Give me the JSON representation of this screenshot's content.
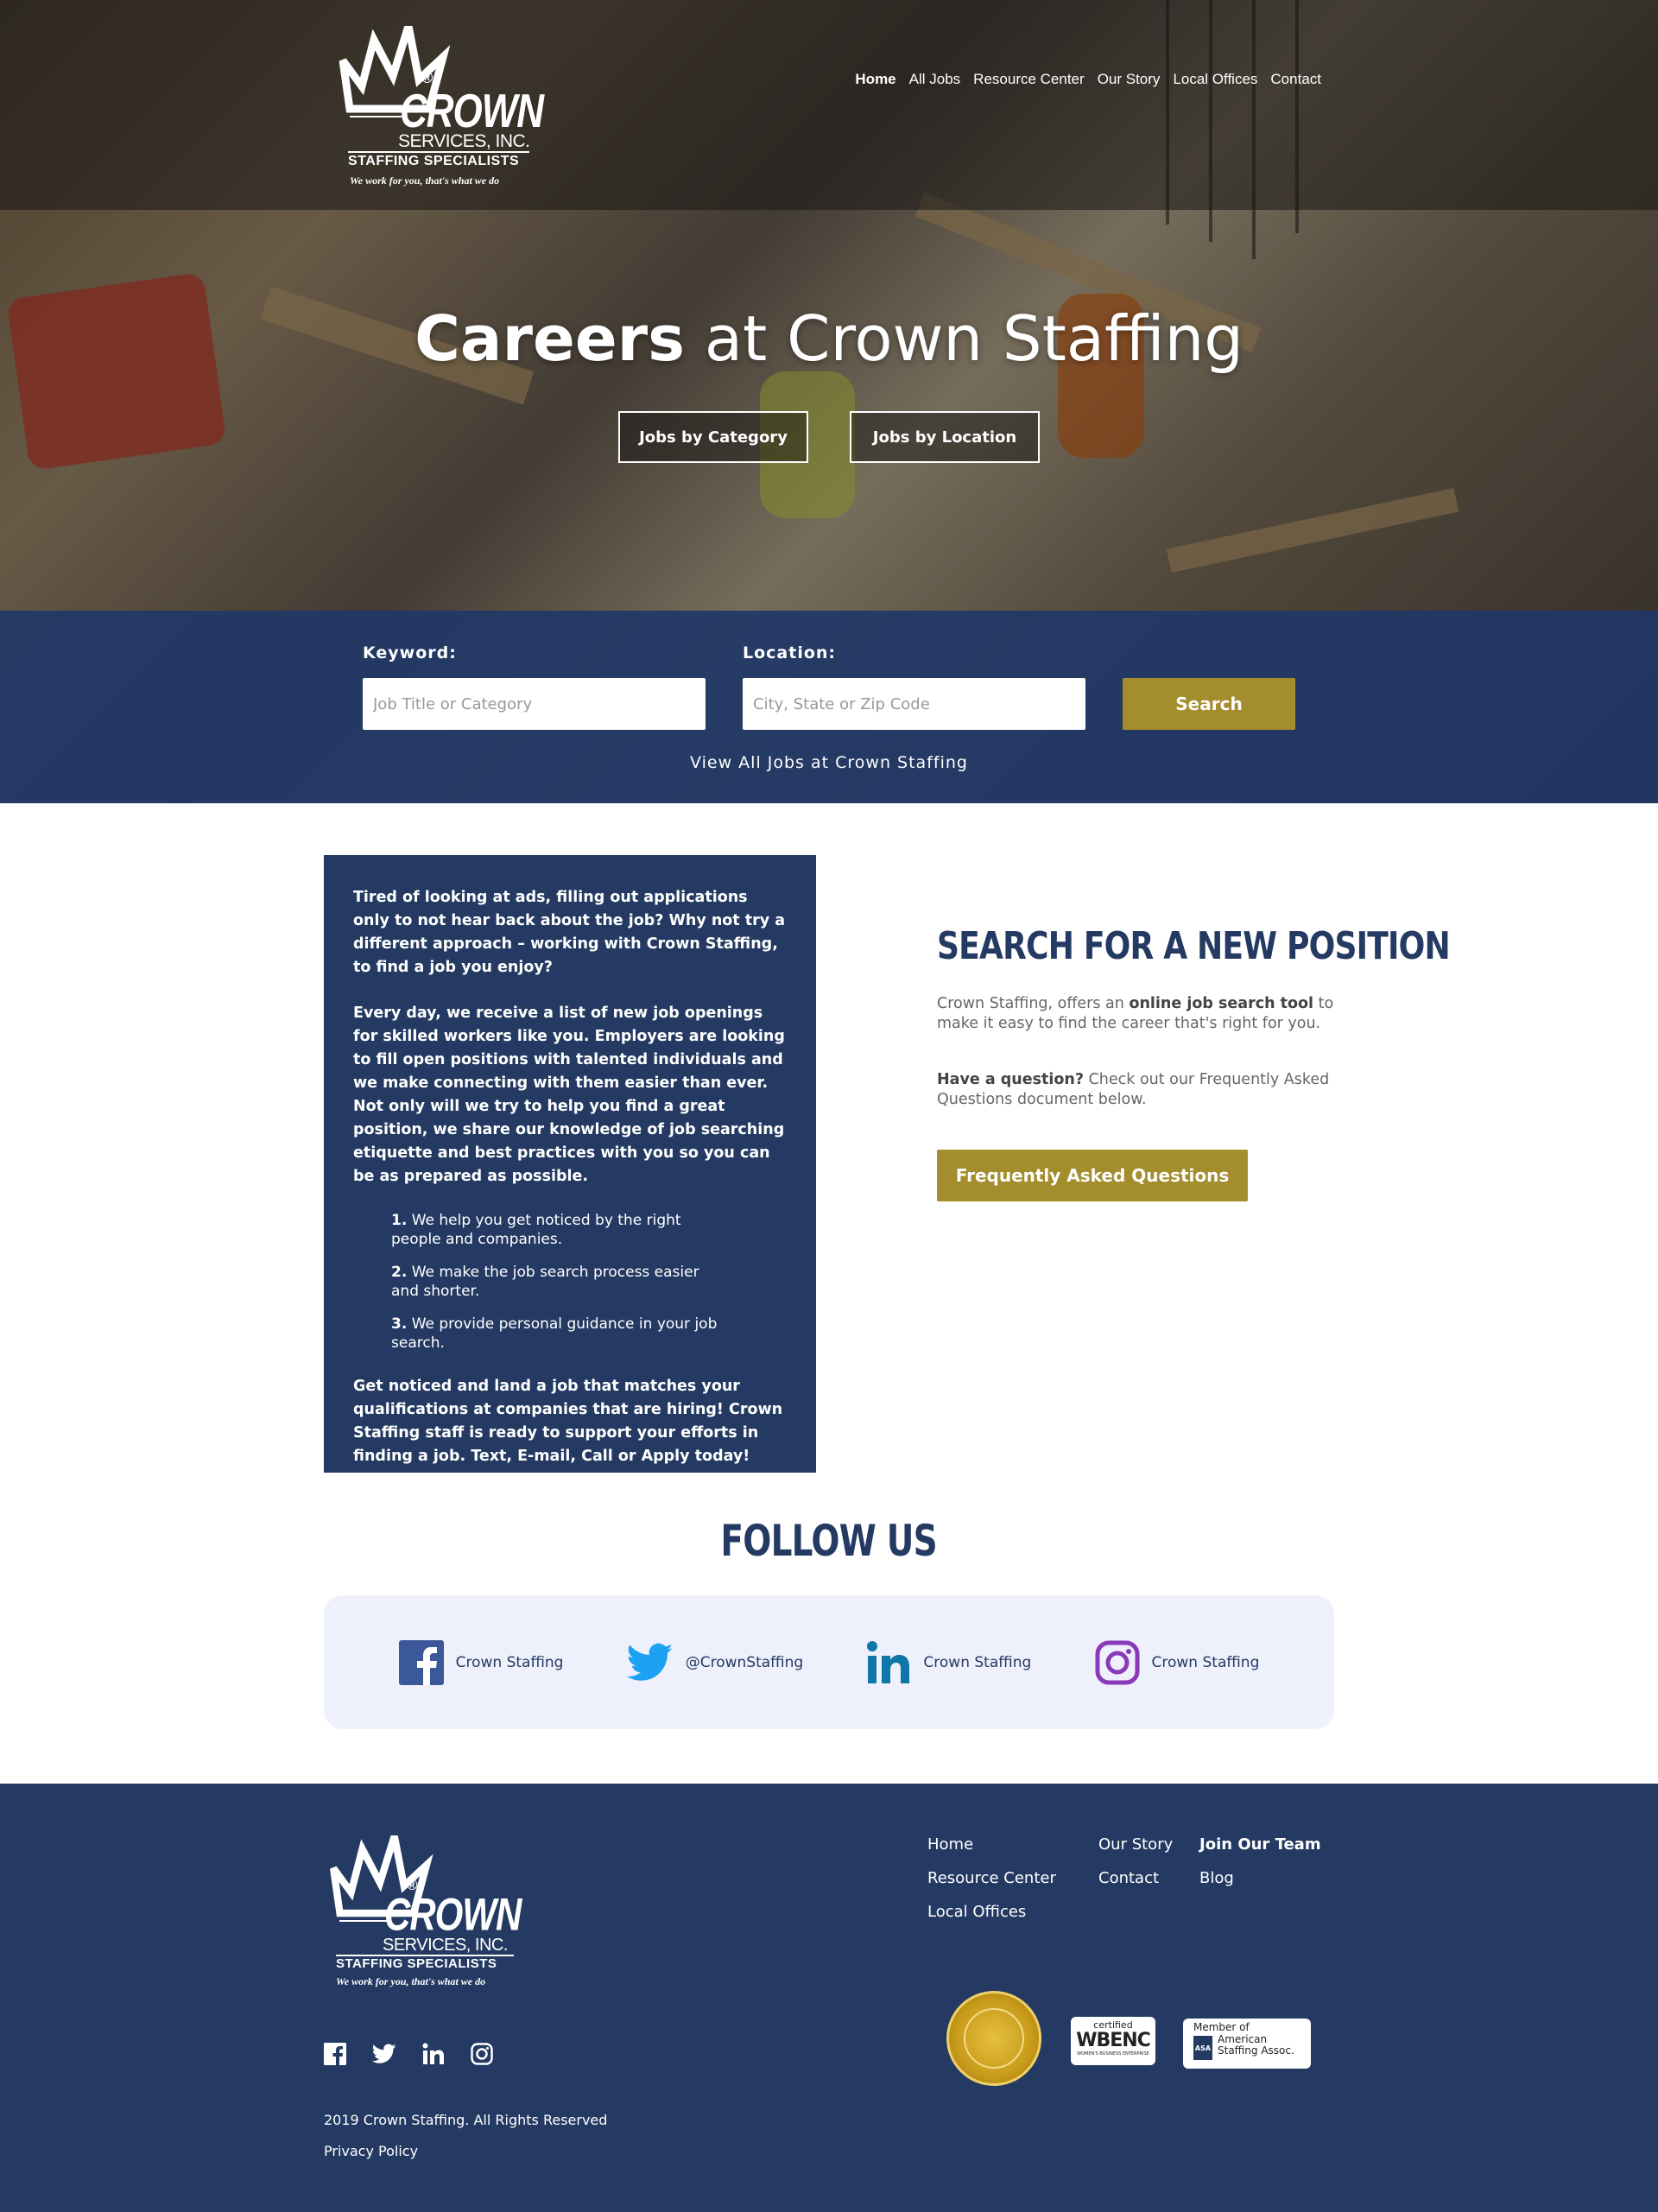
{
  "brand": {
    "name": "CROWN",
    "services": "SERVICES, INC.",
    "specialists": "STAFFING SPECIALISTS",
    "tagline": "We work for you, that's what we do",
    "registered": "®"
  },
  "nav": {
    "items": [
      {
        "label": "Home",
        "active": true
      },
      {
        "label": "All Jobs"
      },
      {
        "label": "Resource Center"
      },
      {
        "label": "Our Story"
      },
      {
        "label": "Local Offices"
      },
      {
        "label": "Contact"
      }
    ]
  },
  "hero": {
    "title_bold": "Careers",
    "title_rest": " at Crown Staffing",
    "btn_category": "Jobs by Category",
    "btn_location": "Jobs by Location"
  },
  "search": {
    "keyword_label": "Keyword:",
    "keyword_placeholder": "Job Title or Category",
    "location_label": "Location:",
    "location_placeholder": "City, State or Zip Code",
    "button": "Search",
    "view_all": "View All Jobs at Crown Staffing"
  },
  "intro": {
    "p1": "Tired of looking at ads, filling out applications only to not hear back about the job? Why not try a different approach – working with Crown Staffing, to find a job you enjoy?",
    "p2": "Every day, we receive a list of new job openings for skilled workers like you. Employers are looking to fill open positions with talented individuals and we make connecting with them easier than ever. Not only will we try to help you find a great position, we share our knowledge of job searching etiquette and best practices with you so you can be as prepared as possible.",
    "list": [
      {
        "num": "1.",
        "text": " We help you get noticed by the right people and companies."
      },
      {
        "num": "2.",
        "text": " We make the job search process easier and shorter."
      },
      {
        "num": "3.",
        "text": " We provide personal guidance in your job search."
      }
    ],
    "p3": "Get noticed and land a job that matches your qualifications at companies that are hiring! Crown Staffing staff is ready to support your efforts in finding a job. Text, E-mail, Call or Apply today!"
  },
  "position": {
    "heading": "SEARCH FOR A NEW POSITION",
    "p1_a": "Crown Staffing, offers an ",
    "p1_b": "online job search tool",
    "p1_c": " to make it easy to find the career that's right for you.",
    "p2_a": "Have a question?",
    "p2_b": " Check out our Frequently Asked Questions document below.",
    "faq_button": "Frequently Asked Questions"
  },
  "follow": {
    "title": "FOLLOW US",
    "items": [
      {
        "icon": "facebook-icon",
        "label": "Crown Staffing",
        "color": "#3b5998"
      },
      {
        "icon": "twitter-icon",
        "label": "@CrownStaffing",
        "color": "#1da1f2"
      },
      {
        "icon": "linkedin-icon",
        "label": "Crown Staffing",
        "color": "#0e76a8"
      },
      {
        "icon": "instagram-icon",
        "label": "Crown Staffing",
        "color": "#8a3ab9"
      }
    ]
  },
  "footer": {
    "links": [
      {
        "label": "Home"
      },
      {
        "label": "Resource Center"
      },
      {
        "label": "Local Offices"
      },
      {
        "label": "Our Story"
      },
      {
        "label": "Contact"
      },
      {
        "label": "Join Our Team",
        "bold": true
      },
      {
        "label": "Blog"
      }
    ],
    "copyright": "2019 Crown Staffing. All Rights Reserved",
    "privacy": "Privacy Policy",
    "badges": {
      "wbenc_top": "certified",
      "wbenc_main": "WBENC",
      "wbenc_sub": "WOMEN'S BUSINESS ENTERPRISE",
      "asa_top": "Member of",
      "asa_line1": "American",
      "asa_line2": "Staffing Assoc.",
      "asa_mark": "ASA"
    }
  },
  "colors": {
    "navy": "#243a62",
    "gold": "#a38d2c",
    "card_bg": "#eef0fb"
  }
}
